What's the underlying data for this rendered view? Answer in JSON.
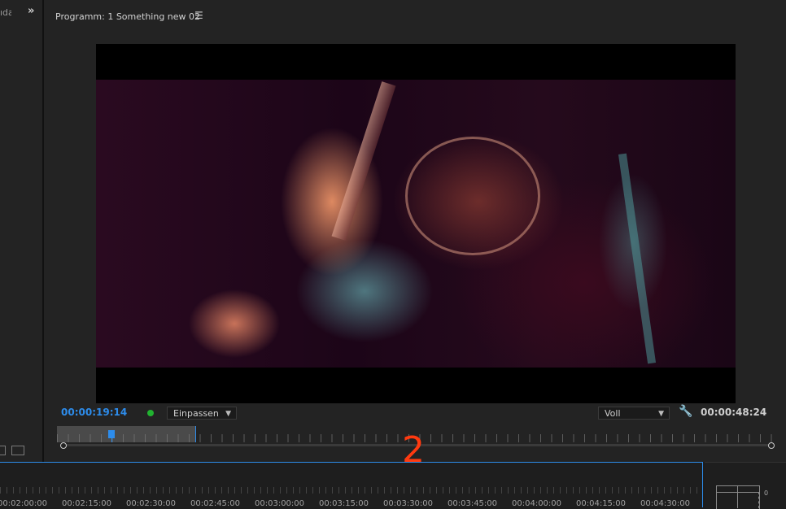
{
  "left_panel": {
    "cut_text": "ıda",
    "expand_icon": "double-chevron-right-icon"
  },
  "program_monitor": {
    "title": "Programm: 1 Something new 02",
    "menu_icon": "hamburger-menu-icon",
    "timecode_current": "00:00:19:14",
    "timecode_duration": "00:00:48:24",
    "fit_dropdown": "Einpassen",
    "resolution_dropdown": "Voll",
    "settings_icon": "wrench-icon",
    "status_dot_color": "#21b230",
    "accent_color": "#2d8ceb"
  },
  "annotation": {
    "text": "2",
    "color": "#ff3a10"
  },
  "timeline": {
    "labels": [
      "00:02:00:00",
      "00:02:15:00",
      "00:02:30:00",
      "00:02:45:00",
      "00:03:00:00",
      "00:03:15:00",
      "00:03:30:00",
      "00:03:45:00",
      "00:04:00:00",
      "00:04:15:00",
      "00:04:30:00"
    ]
  },
  "audio_meter": {
    "zero_label": "0"
  }
}
